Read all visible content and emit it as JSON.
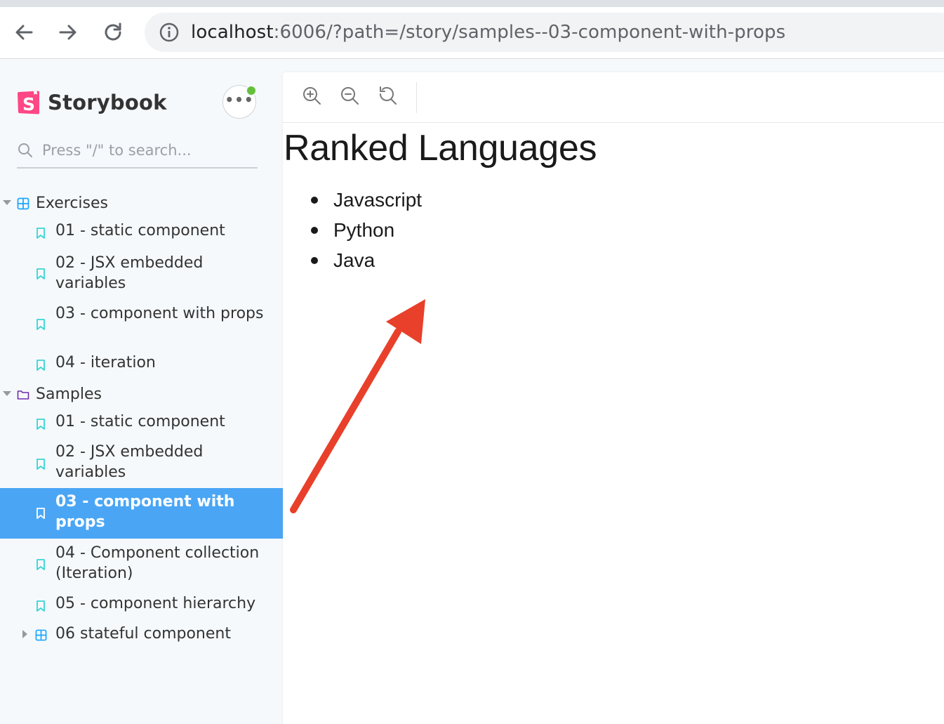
{
  "browser": {
    "url_host": "localhost",
    "url_rest": ":6006/?path=/story/samples--03-component-with-props",
    "back_icon": "back-arrow-icon",
    "forward_icon": "forward-arrow-icon",
    "reload_icon": "reload-icon",
    "info_icon": "info-icon"
  },
  "sidebar": {
    "brand": "Storybook",
    "search_placeholder": "Press \"/\" to search...",
    "groups": [
      {
        "label": "Exercises",
        "stories": [
          "01 - static component",
          "02 - JSX embedded variables",
          "03 - component with props",
          "04 - iteration"
        ]
      },
      {
        "label": "Samples",
        "stories": [
          "01 - static component",
          "02 - JSX embedded variables",
          "03 - component with props",
          "04 - Component collection (Iteration)",
          "05 - component hierarchy"
        ],
        "subgroup": "06 stateful component"
      }
    ],
    "active_story": "03 - component with props"
  },
  "preview": {
    "heading": "Ranked Languages",
    "items": [
      "Javascript",
      "Python",
      "Java"
    ]
  },
  "colors": {
    "accent": "#4aa6f5",
    "story_icon": "#37d5d3",
    "arrow": "#e8402a",
    "brand_pink": "#ff4785"
  }
}
